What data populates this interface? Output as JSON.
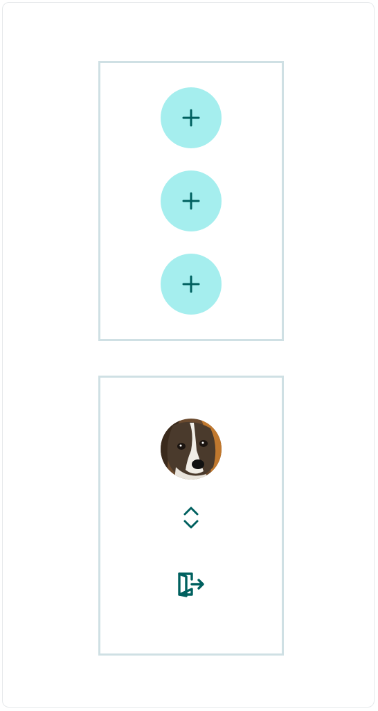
{
  "colors": {
    "accent_bg": "#a5eeee",
    "accent_fg": "#00605f",
    "panel_border": "#cfe0e4"
  },
  "quick_actions": [
    {
      "icon": "plus-icon"
    },
    {
      "icon": "plus-icon"
    },
    {
      "icon": "plus-icon"
    }
  ],
  "account": {
    "avatar_icon": "dog-photo-avatar",
    "switch_icon": "chevron-up-down-icon",
    "logout_icon": "logout-icon"
  }
}
